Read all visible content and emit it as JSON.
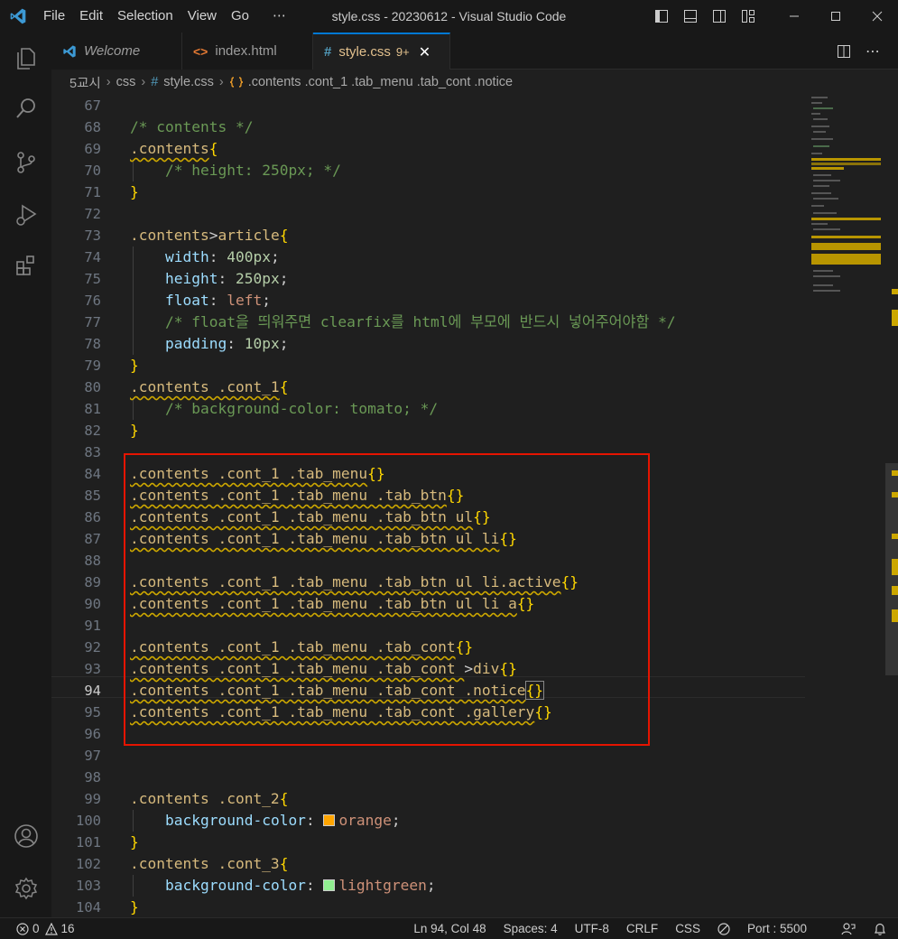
{
  "titlebar": {
    "menu": [
      "File",
      "Edit",
      "Selection",
      "View",
      "Go",
      "⋯"
    ],
    "title": "style.css - 20230612 - Visual Studio Code"
  },
  "tabs": [
    {
      "label": "Welcome",
      "icon": "vscode-logo-icon"
    },
    {
      "label": "index.html",
      "icon": "html-file-icon"
    },
    {
      "label": "style.css",
      "icon": "css-file-icon",
      "badge": "9+",
      "active": true
    }
  ],
  "breadcrumb": {
    "items": [
      "5교시",
      "css",
      "style.css",
      ".contents .cont_1 .tab_menu .tab_cont .notice"
    ]
  },
  "editor": {
    "current_line": 94,
    "lines": [
      {
        "n": "67"
      },
      {
        "n": "68"
      },
      {
        "n": "69"
      },
      {
        "n": "70"
      },
      {
        "n": "71"
      },
      {
        "n": "72"
      },
      {
        "n": "73"
      },
      {
        "n": "74"
      },
      {
        "n": "75"
      },
      {
        "n": "76"
      },
      {
        "n": "77"
      },
      {
        "n": "78"
      },
      {
        "n": "79"
      },
      {
        "n": "80"
      },
      {
        "n": "81"
      },
      {
        "n": "82"
      },
      {
        "n": "83"
      },
      {
        "n": "84"
      },
      {
        "n": "85"
      },
      {
        "n": "86"
      },
      {
        "n": "87"
      },
      {
        "n": "88"
      },
      {
        "n": "89"
      },
      {
        "n": "90"
      },
      {
        "n": "91"
      },
      {
        "n": "92"
      },
      {
        "n": "93"
      },
      {
        "n": "94"
      },
      {
        "n": "95"
      },
      {
        "n": "96"
      },
      {
        "n": "97"
      },
      {
        "n": "98"
      },
      {
        "n": "99"
      },
      {
        "n": "100"
      },
      {
        "n": "101"
      },
      {
        "n": "102"
      },
      {
        "n": "103"
      },
      {
        "n": "104"
      }
    ],
    "code": {
      "l68": "/* contents */",
      "l69": ".contents",
      "l70": "/* height: 250px; */",
      "l73a": ".contents",
      "l73b": ">",
      "l73c": "article",
      "l74p": "width",
      "l74v": "400px",
      "l75p": "height",
      "l75v": "250px",
      "l76p": "float",
      "l76v": "left",
      "l77": "/* float을 띄워주면 clearfix를 html에 부모에 반드시 넣어주어야함 */",
      "l78p": "padding",
      "l78v": "10px",
      "l80": ".contents .cont_1",
      "l81": "/* background-color: tomato; */",
      "l84": ".contents .cont_1 .tab_menu",
      "l85": ".contents .cont_1 .tab_menu .tab_btn",
      "l86": ".contents .cont_1 .tab_menu .tab_btn ul",
      "l87": ".contents .cont_1 .tab_menu .tab_btn ul li",
      "l89": ".contents .cont_1 .tab_menu .tab_btn ul li.active",
      "l90": ".contents .cont_1 .tab_menu .tab_btn ul li a",
      "l92": ".contents .cont_1 .tab_menu .tab_cont",
      "l93a": ".contents .cont_1 .tab_menu .tab_cont ",
      "l93b": ">",
      "l93c": "div",
      "l94": ".contents .cont_1 .tab_menu .tab_cont .notice",
      "l95": ".contents .cont_1 .tab_menu .tab_cont .gallery",
      "l99": ".contents .cont_2",
      "l100p": "background-color",
      "l100v": "orange",
      "l102": ".contents .cont_3",
      "l103p": "background-color",
      "l103v": "lightgreen"
    },
    "swatch_colors": {
      "orange": "#ffa500",
      "lightgreen": "#90ee90"
    }
  },
  "status": {
    "errors": "0",
    "warnings": "16",
    "position": "Ln 94, Col 48",
    "spaces": "Spaces: 4",
    "encoding": "UTF-8",
    "eol": "CRLF",
    "language": "CSS",
    "port": "Port : 5500"
  },
  "colors": {
    "accent": "#0078d4",
    "highlight_box": "#e51400",
    "squiggle": "#cca700"
  }
}
